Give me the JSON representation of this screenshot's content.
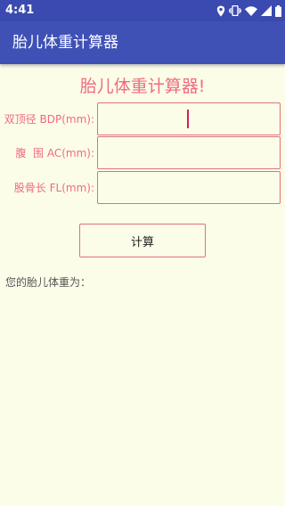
{
  "status_bar": {
    "time": "4:41",
    "icons": [
      "location-icon",
      "vibrate-icon",
      "wifi-icon",
      "signal-icon",
      "battery-icon"
    ]
  },
  "app_bar": {
    "title": "胎儿体重计算器"
  },
  "main": {
    "heading": "胎儿体重计算器!",
    "fields": [
      {
        "label": "双顶径 BDP(mm):",
        "value": "",
        "placeholder": ""
      },
      {
        "label": "腹  围 AC(mm):",
        "value": "",
        "placeholder": ""
      },
      {
        "label": "股骨长 FL(mm):",
        "value": "",
        "placeholder": ""
      }
    ],
    "calculate_label": "计算",
    "result_label": "您的胎儿体重为："
  },
  "colors": {
    "status_bar": "#3a4ab0",
    "app_bar": "#3f51b5",
    "background": "#fbfde9",
    "accent": "#ef6b7f",
    "cursor": "#d81b60"
  }
}
